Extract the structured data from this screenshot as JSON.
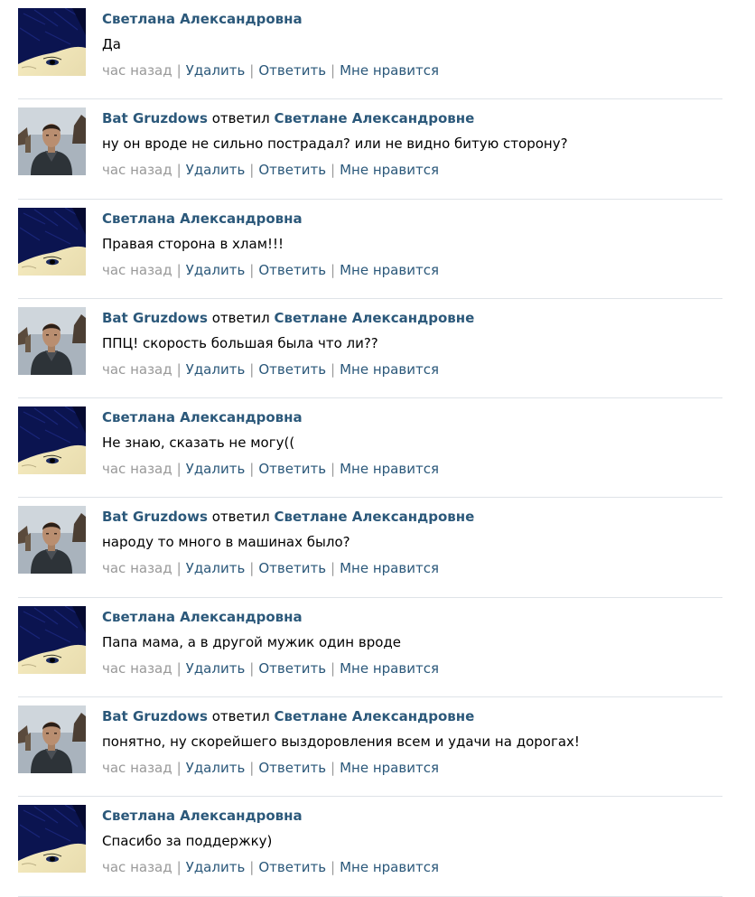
{
  "comments": [
    {
      "author": "Светлана Александровна",
      "reply_word": "",
      "reply_to": "",
      "text": "Да",
      "avatar": "svetlana-avatar",
      "time": "час назад",
      "delete": "Удалить",
      "reply": "Ответить",
      "like": "Мне нравится"
    },
    {
      "author": "Bat Gruzdows",
      "reply_word": "ответил",
      "reply_to": "Светлане Александровне",
      "text": "ну он вроде не сильно пострадал? или не видно битую сторону?",
      "avatar": "bat-avatar",
      "time": "час назад",
      "delete": "Удалить",
      "reply": "Ответить",
      "like": "Мне нравится"
    },
    {
      "author": "Светлана Александровна",
      "reply_word": "",
      "reply_to": "",
      "text": "Правая сторона в хлам!!!",
      "avatar": "svetlana-avatar",
      "time": "час назад",
      "delete": "Удалить",
      "reply": "Ответить",
      "like": "Мне нравится"
    },
    {
      "author": "Bat Gruzdows",
      "reply_word": "ответил",
      "reply_to": "Светлане Александровне",
      "text": "ППЦ! скорость большая была что ли??",
      "avatar": "bat-avatar",
      "time": "час назад",
      "delete": "Удалить",
      "reply": "Ответить",
      "like": "Мне нравится"
    },
    {
      "author": "Светлана Александровна",
      "reply_word": "",
      "reply_to": "",
      "text": "Не знаю, сказать не могу((",
      "avatar": "svetlana-avatar",
      "time": "час назад",
      "delete": "Удалить",
      "reply": "Ответить",
      "like": "Мне нравится"
    },
    {
      "author": "Bat Gruzdows",
      "reply_word": "ответил",
      "reply_to": "Светлане Александровне",
      "text": "народу то много в машинах было?",
      "avatar": "bat-avatar",
      "time": "час назад",
      "delete": "Удалить",
      "reply": "Ответить",
      "like": "Мне нравится"
    },
    {
      "author": "Светлана Александровна",
      "reply_word": "",
      "reply_to": "",
      "text": "Папа мама, а в другой мужик один вроде",
      "avatar": "svetlana-avatar",
      "time": "час назад",
      "delete": "Удалить",
      "reply": "Ответить",
      "like": "Мне нравится"
    },
    {
      "author": "Bat Gruzdows",
      "reply_word": "ответил",
      "reply_to": "Светлане Александровне",
      "text": "понятно, ну скорейшего выздоровления всем и удачи на дорогах!",
      "avatar": "bat-avatar",
      "time": "час назад",
      "delete": "Удалить",
      "reply": "Ответить",
      "like": "Мне нравится"
    },
    {
      "author": "Светлана Александровна",
      "reply_word": "",
      "reply_to": "",
      "text": "Спасибо за поддержку)",
      "avatar": "svetlana-avatar",
      "time": "час назад",
      "delete": "Удалить",
      "reply": "Ответить",
      "like": "Мне нравится"
    }
  ],
  "colors": {
    "link": "#2b587a",
    "muted": "#999999",
    "divider": "#dfe3e8"
  }
}
